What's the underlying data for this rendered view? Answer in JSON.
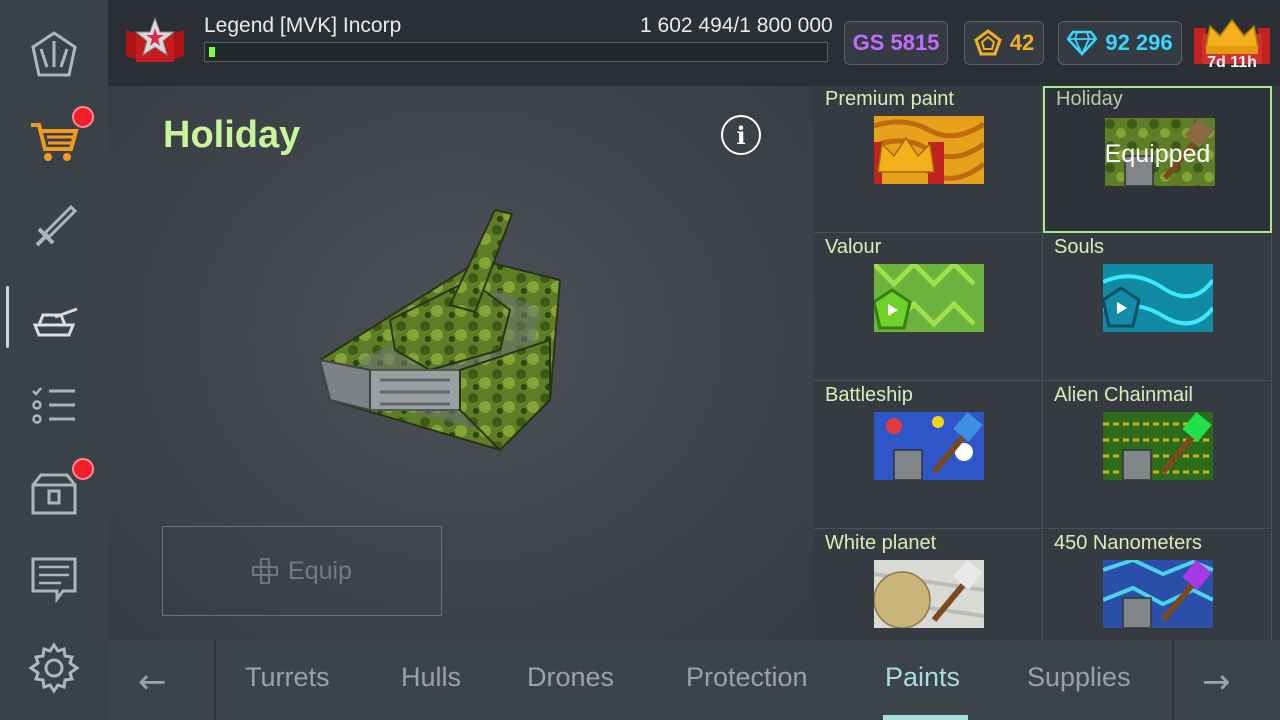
{
  "player": {
    "rank_badge": "legend-rank-icon",
    "name": "Legend  [MVK] Incorp"
  },
  "experience": {
    "text": "1 602 494/1 800 000",
    "current": 1602494,
    "max": 1800000
  },
  "currencies": {
    "gs": "GS 5815",
    "tokens": "42",
    "crystals": "92 296"
  },
  "premium": {
    "time_left": "7d 11h"
  },
  "sidebar": {
    "items": [
      {
        "name": "home-icon"
      },
      {
        "name": "shop-cart-icon",
        "badge": true
      },
      {
        "name": "weapon-sword-icon"
      },
      {
        "name": "garage-tank-icon",
        "active": true
      },
      {
        "name": "missions-list-icon"
      },
      {
        "name": "containers-icon",
        "badge": true
      },
      {
        "name": "news-icon"
      },
      {
        "name": "settings-gear-icon"
      }
    ]
  },
  "item": {
    "title": "Holiday",
    "equip_label": "Equip"
  },
  "paints": [
    {
      "label": "Premium paint"
    },
    {
      "label": "Holiday",
      "status": "Equipped"
    },
    {
      "label": "Valour"
    },
    {
      "label": "Souls"
    },
    {
      "label": "Battleship"
    },
    {
      "label": "Alien Chainmail"
    },
    {
      "label": "White planet"
    },
    {
      "label": "450 Nanometers"
    }
  ],
  "tabs": [
    "Turrets",
    "Hulls",
    "Drones",
    "Protection",
    "Paints",
    "Supplies"
  ],
  "active_tab": "Paints",
  "colors": {
    "accent_green": "#c9f49a",
    "active_tab": "#a7dede",
    "gs_purple": "#c46bff",
    "token_gold": "#f2b01e",
    "crystal_cyan": "#36d6ff"
  }
}
